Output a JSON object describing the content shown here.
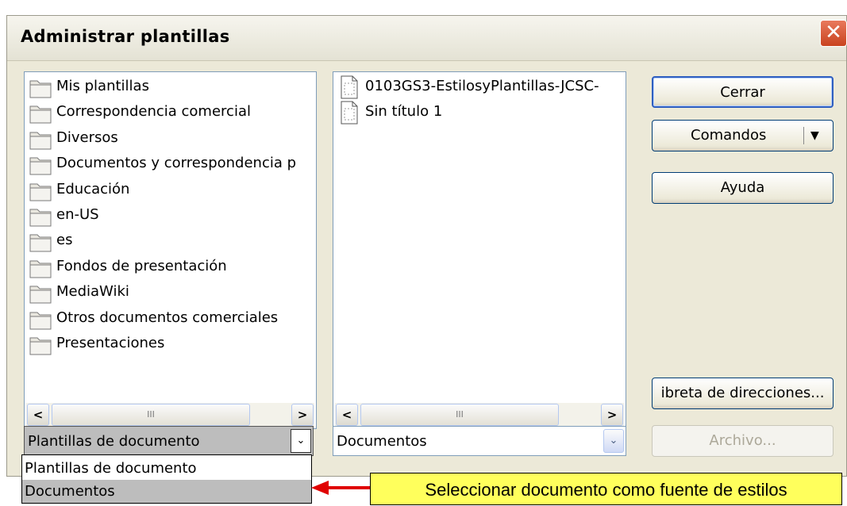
{
  "dialog": {
    "title": "Administrar plantillas",
    "close_glyph": "✕"
  },
  "categories": {
    "items": [
      {
        "label": "Mis plantillas"
      },
      {
        "label": "Correspondencia comercial"
      },
      {
        "label": "Diversos"
      },
      {
        "label": "Documentos y correspondencia p"
      },
      {
        "label": "Educación"
      },
      {
        "label": "en-US"
      },
      {
        "label": "es"
      },
      {
        "label": "Fondos de presentación"
      },
      {
        "label": "MediaWiki"
      },
      {
        "label": "Otros documentos comerciales"
      },
      {
        "label": "Presentaciones"
      }
    ],
    "scroll_left": "<",
    "scroll_right": ">",
    "thumb_grip": "III"
  },
  "documents": {
    "items": [
      {
        "label": "0103GS3-EstilosyPlantillas-JCSC-"
      },
      {
        "label": "Sin título 1"
      }
    ],
    "scroll_left": "<",
    "scroll_right": ">",
    "thumb_grip": "III"
  },
  "buttons": {
    "close": "Cerrar",
    "commands": "Comandos",
    "help": "Ayuda",
    "address_book": "ibreta de direcciones...",
    "file": "Archivo..."
  },
  "left_combo": {
    "value": "Plantillas de documento",
    "arrow": "⌄"
  },
  "right_combo": {
    "value": "Documentos",
    "arrow": "⌄"
  },
  "dropdown_options": [
    "Plantillas de documento",
    "Documentos"
  ],
  "dropdown_selected": "Documentos",
  "callout": {
    "text": "Seleccionar documento como fuente de estilos"
  },
  "colors": {
    "callout_bg": "#ffff5c",
    "arrow": "#e00000",
    "close_button": "#d2502e"
  }
}
